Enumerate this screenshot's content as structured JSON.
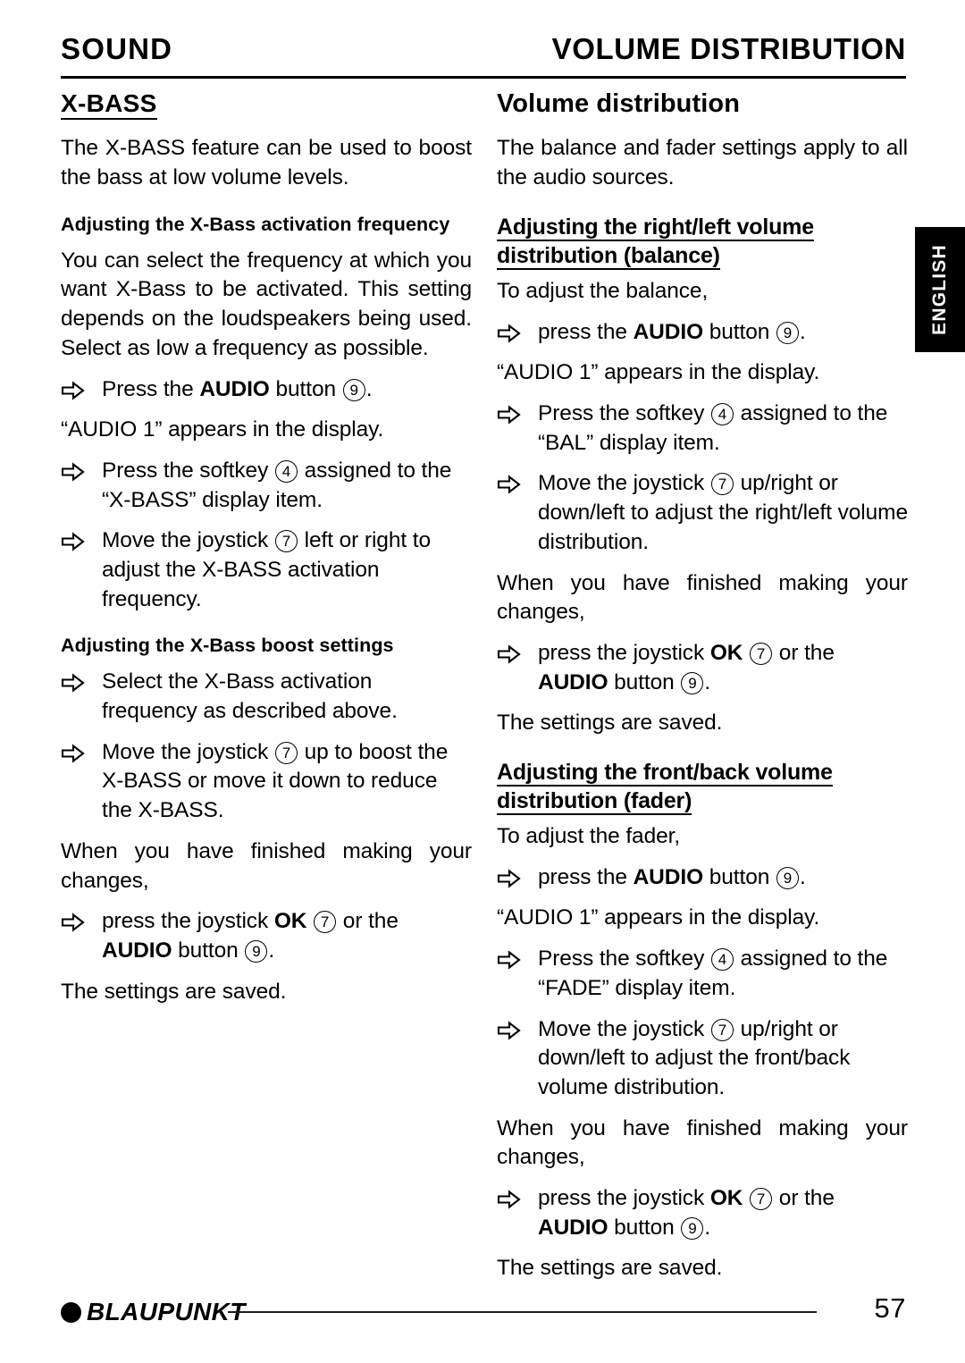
{
  "header": {
    "left_title": "SOUND",
    "right_title": "VOLUME DISTRIBUTION"
  },
  "language_tab": {
    "label": "ENGLISH"
  },
  "left_column": {
    "heading": "X-BASS",
    "intro": "The X-BASS feature can be used to boost the bass at low volume levels.",
    "sub1": {
      "title": "Adjusting the X-Bass activation frequency",
      "paragraph": "You can select the frequency at which you want X-Bass to be activated. This setting depends on the loudspeakers being used. Select as low a frequency as possible.",
      "step1_pre": "Press the ",
      "step1_bold": "AUDIO",
      "step1_mid": " button ",
      "step1_key": "9",
      "step1_post": ".",
      "note1": "“AUDIO 1” appears in the display.",
      "step2_pre": "Press the softkey ",
      "step2_key": "4",
      "step2_post": " assigned to the “X-BASS” display item.",
      "step3_pre": "Move the joystick ",
      "step3_key": "7",
      "step3_post": " left or right to adjust the X-BASS activation frequency."
    },
    "sub2": {
      "title": "Adjusting the X-Bass boost settings",
      "step1": "Select the X-Bass activation frequency as described above.",
      "step2_pre": "Move the joystick ",
      "step2_key": "7",
      "step2_post": " up to boost the X-BASS or move it down to reduce the X-BASS.",
      "note": "When you have finished making your changes,",
      "step3_pre": "press the joystick ",
      "step3_bold1": "OK",
      "step3_mid1": " ",
      "step3_key1": "7",
      "step3_mid2": " or the ",
      "step3_bold2": "AUDIO",
      "step3_mid3": " button ",
      "step3_key2": "9",
      "step3_post": ".",
      "saved": "The settings are saved."
    }
  },
  "right_column": {
    "heading": "Volume distribution",
    "intro": "The balance and fader settings apply to all the audio sources.",
    "balance": {
      "title_line1": "Adjusting the right/left volume",
      "title_line2": "distribution (balance)",
      "lead": "To adjust the balance,",
      "step1_pre": "press the ",
      "step1_bold": "AUDIO",
      "step1_mid": " button ",
      "step1_key": "9",
      "step1_post": ".",
      "note1": "“AUDIO 1” appears in the display.",
      "step2_pre": "Press the softkey ",
      "step2_key": "4",
      "step2_post": " assigned to the “BAL” display item.",
      "step3_pre": "Move the joystick ",
      "step3_key": "7",
      "step3_post": " up/right or down/left to adjust the right/left volume distribution.",
      "note2": "When you have finished making your changes,",
      "step4_pre": "press the joystick ",
      "step4_bold1": "OK",
      "step4_mid1": " ",
      "step4_key1": "7",
      "step4_mid2": " or the ",
      "step4_bold2": "AUDIO",
      "step4_mid3": " button ",
      "step4_key2": "9",
      "step4_post": ".",
      "saved": "The settings are saved."
    },
    "fader": {
      "title_line1": "Adjusting the front/back volume",
      "title_line2": "distribution (fader)",
      "lead": "To adjust the fader,",
      "step1_pre": "press the ",
      "step1_bold": "AUDIO",
      "step1_mid": " button ",
      "step1_key": "9",
      "step1_post": ".",
      "note1": "“AUDIO 1” appears in the display.",
      "step2_pre": "Press the softkey ",
      "step2_key": "4",
      "step2_post": " assigned to the “FADE” display item.",
      "step3_pre": "Move the joystick ",
      "step3_key": "7",
      "step3_post": " up/right or down/left to adjust the front/back volume distribution.",
      "note2": "When you have finished making your changes,",
      "step4_pre": "press the joystick ",
      "step4_bold1": "OK",
      "step4_mid1": " ",
      "step4_key1": "7",
      "step4_mid2": " or the ",
      "step4_bold2": "AUDIO",
      "step4_mid3": " button ",
      "step4_key2": "9",
      "step4_post": ".",
      "saved": "The settings are saved."
    }
  },
  "footer": {
    "brand": "BLAUPUNKT",
    "page_number": "57"
  }
}
